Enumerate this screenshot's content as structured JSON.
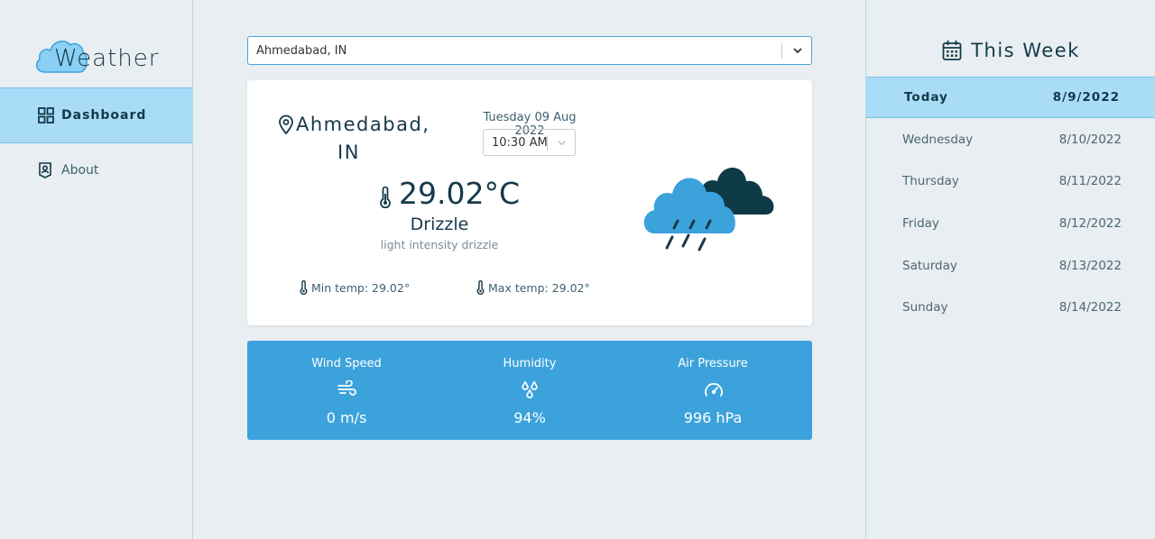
{
  "app": {
    "title": "Weather"
  },
  "sidebar": {
    "items": [
      {
        "label": "Dashboard",
        "icon": "grid-icon",
        "active": true
      },
      {
        "label": "About",
        "icon": "user-badge-icon",
        "active": false
      }
    ]
  },
  "search": {
    "value": "Ahmedabad, IN"
  },
  "current": {
    "location_line1": "Ahmedabad,",
    "location_line2": "IN",
    "date": "Tuesday 09 Aug 2022",
    "time": "10:30 AM",
    "temperature": "29.02°C",
    "condition": "Drizzle",
    "description": "light intensity drizzle",
    "min_temp": "Min temp: 29.02°",
    "max_temp": "Max temp: 29.02°",
    "icon": "rain-cloud-icon"
  },
  "stats": {
    "wind": {
      "label": "Wind Speed",
      "value": "0 m/s",
      "icon": "wind-icon"
    },
    "humidity": {
      "label": "Humidity",
      "value": "94%",
      "icon": "droplets-icon"
    },
    "pressure": {
      "label": "Air Pressure",
      "value": "996 hPa",
      "icon": "gauge-icon"
    }
  },
  "week": {
    "title": "This Week",
    "days": [
      {
        "day": "Today",
        "date": "8/9/2022",
        "active": true
      },
      {
        "day": "Wednesday",
        "date": "8/10/2022"
      },
      {
        "day": "Thursday",
        "date": "8/11/2022"
      },
      {
        "day": "Friday",
        "date": "8/12/2022"
      },
      {
        "day": "Saturday",
        "date": "8/13/2022"
      },
      {
        "day": "Sunday",
        "date": "8/14/2022"
      }
    ]
  },
  "colors": {
    "accent": "#3ca2db",
    "active_bg": "#a8dcf7",
    "dark_text": "#16394a",
    "background": "#e8eef1"
  }
}
